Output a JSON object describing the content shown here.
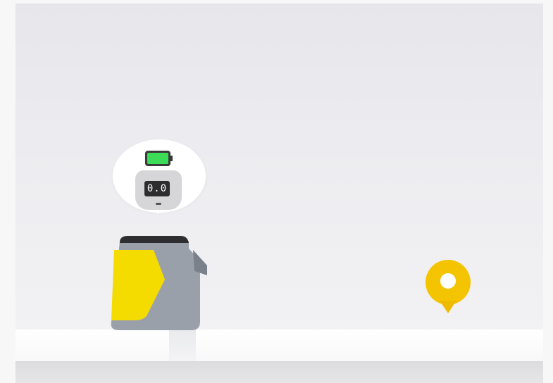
{
  "status_bubble": {
    "battery_level": 1.0,
    "display_value": "0.0",
    "colors": {
      "battery": "#3ddc58",
      "screen": "#2d2d2f"
    }
  },
  "robot": {
    "accent_color": "#f5dc00",
    "body_color": "#9aa0aa",
    "icon": "delivery-robot-icon"
  },
  "destination": {
    "icon": "location-pin-icon",
    "color": "#f5c400"
  },
  "scene": {
    "background": "#ececf0",
    "beam": "#ffffff"
  }
}
